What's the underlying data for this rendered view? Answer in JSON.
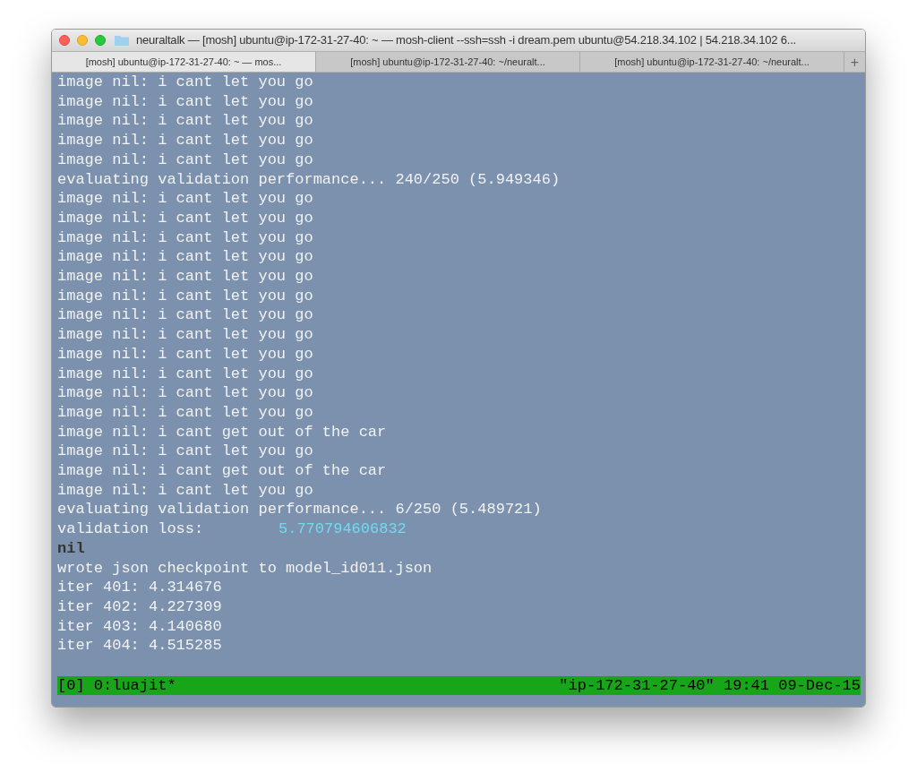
{
  "window": {
    "title": "neuraltalk — [mosh] ubuntu@ip-172-31-27-40: ~ — mosh-client --ssh=ssh -i dream.pem ubuntu@54.218.34.102 | 54.218.34.102 6..."
  },
  "tabs": [
    {
      "label": "[mosh] ubuntu@ip-172-31-27-40: ~ — mos...",
      "selected": true
    },
    {
      "label": "[mosh] ubuntu@ip-172-31-27-40: ~/neuralt...",
      "selected": false
    },
    {
      "label": "[mosh] ubuntu@ip-172-31-27-40: ~/neuralt...",
      "selected": false
    }
  ],
  "new_tab": "+",
  "terminal": {
    "lines": [
      {
        "kind": "text",
        "text": "image nil: i cant let you go"
      },
      {
        "kind": "text",
        "text": "image nil: i cant let you go"
      },
      {
        "kind": "text",
        "text": "image nil: i cant let you go"
      },
      {
        "kind": "text",
        "text": "image nil: i cant let you go"
      },
      {
        "kind": "text",
        "text": "image nil: i cant let you go"
      },
      {
        "kind": "text",
        "text": "evaluating validation performance... 240/250 (5.949346)"
      },
      {
        "kind": "text",
        "text": "image nil: i cant let you go"
      },
      {
        "kind": "text",
        "text": "image nil: i cant let you go"
      },
      {
        "kind": "text",
        "text": "image nil: i cant let you go"
      },
      {
        "kind": "text",
        "text": "image nil: i cant let you go"
      },
      {
        "kind": "text",
        "text": "image nil: i cant let you go"
      },
      {
        "kind": "text",
        "text": "image nil: i cant let you go"
      },
      {
        "kind": "text",
        "text": "image nil: i cant let you go"
      },
      {
        "kind": "text",
        "text": "image nil: i cant let you go"
      },
      {
        "kind": "text",
        "text": "image nil: i cant let you go"
      },
      {
        "kind": "text",
        "text": "image nil: i cant let you go"
      },
      {
        "kind": "text",
        "text": "image nil: i cant let you go"
      },
      {
        "kind": "text",
        "text": "image nil: i cant let you go"
      },
      {
        "kind": "text",
        "text": "image nil: i cant get out of the car"
      },
      {
        "kind": "text",
        "text": "image nil: i cant let you go"
      },
      {
        "kind": "text",
        "text": "image nil: i cant get out of the car"
      },
      {
        "kind": "text",
        "text": "image nil: i cant let you go"
      },
      {
        "kind": "text",
        "text": "evaluating validation performance... 6/250 (5.489721)"
      },
      {
        "kind": "value",
        "text": "validation loss:",
        "value": "5.770794606832"
      },
      {
        "kind": "bold",
        "text": "nil"
      },
      {
        "kind": "text",
        "text": "wrote json checkpoint to model_id011.json"
      },
      {
        "kind": "text",
        "text": "iter 401: 4.314676"
      },
      {
        "kind": "text",
        "text": "iter 402: 4.227309"
      },
      {
        "kind": "text",
        "text": "iter 403: 4.140680"
      },
      {
        "kind": "text",
        "text": "iter 404: 4.515285"
      }
    ]
  },
  "status_bar": {
    "left": "[0] 0:luajit*",
    "right": "\"ip-172-31-27-40\" 19:41 09-Dec-15"
  }
}
